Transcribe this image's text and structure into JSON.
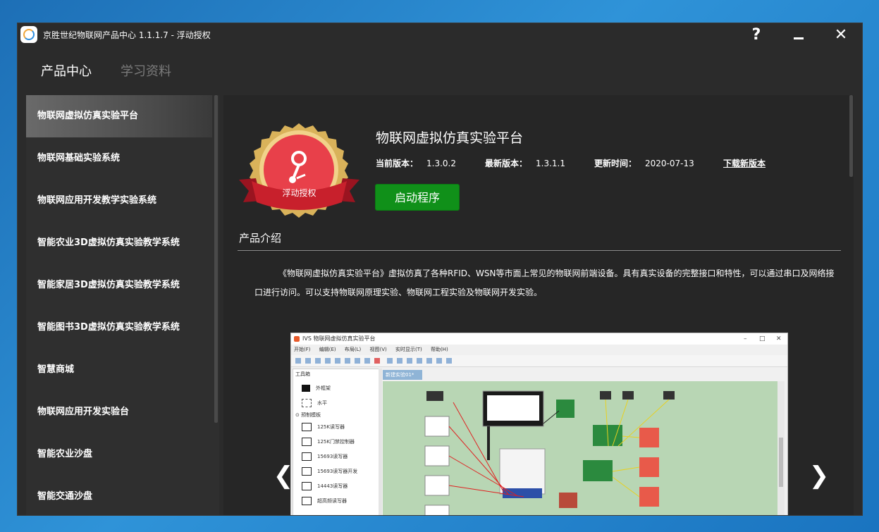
{
  "window": {
    "title": "京胜世纪物联网产品中心 1.1.1.7 - 浮动授权",
    "help_glyph": "?",
    "close_glyph": "✕"
  },
  "nav": {
    "tabs": [
      {
        "label": "产品中心",
        "active": true
      },
      {
        "label": "学习资料",
        "active": false
      }
    ]
  },
  "sidebar": {
    "items": [
      {
        "label": "物联网虚拟仿真实验平台",
        "selected": true
      },
      {
        "label": "物联网基础实验系统"
      },
      {
        "label": "物联网应用开发教学实验系统"
      },
      {
        "label": "智能农业3D虚拟仿真实验教学系统"
      },
      {
        "label": "智能家居3D虚拟仿真实验教学系统"
      },
      {
        "label": "智能图书3D虚拟仿真实验教学系统"
      },
      {
        "label": "智慧商城"
      },
      {
        "label": "物联网应用开发实验台"
      },
      {
        "label": "智能农业沙盘"
      },
      {
        "label": "智能交通沙盘"
      }
    ]
  },
  "product": {
    "badge_text": "浮动授权",
    "name": "物联网虚拟仿真实验平台",
    "current_version_label": "当前版本：",
    "current_version": "1.3.0.2",
    "latest_version_label": "最新版本：",
    "latest_version": "1.3.1.1",
    "update_time_label": "更新时间：",
    "update_time": "2020-07-13",
    "download_label": "下载新版本",
    "launch_label": "启动程序",
    "intro_title": "产品介绍",
    "description": "《物联网虚拟仿真实验平台》虚拟仿真了各种RFID、WSN等市面上常见的物联网前端设备。具有真实设备的完整接口和特性，可以通过串口及网络接口进行访问。可以支持物联网原理实验、物联网工程实验及物联网开发实验。"
  },
  "gallery": {
    "prev_glyph": "❮",
    "next_glyph": "❯",
    "screenshot": {
      "title": "IVS 物联网虚拟仿真实验平台",
      "menu": [
        "开始(F)",
        "编辑(E)",
        "布局(L)",
        "视图(V)",
        "实时显示(T)",
        "帮助(H)"
      ],
      "panel_title": "工具箱",
      "panel_items": [
        "外框架",
        "水平",
        "预制模板",
        "125K读写器",
        "125K门禁控制器",
        "15693读写器",
        "15693读写器开发",
        "14443读写器",
        "超高频读写器"
      ],
      "tab_label": "新建实验01*"
    }
  },
  "colors": {
    "accent_green": "#109019",
    "badge_red": "#e8404a",
    "badge_gold": "#d9b25a"
  }
}
